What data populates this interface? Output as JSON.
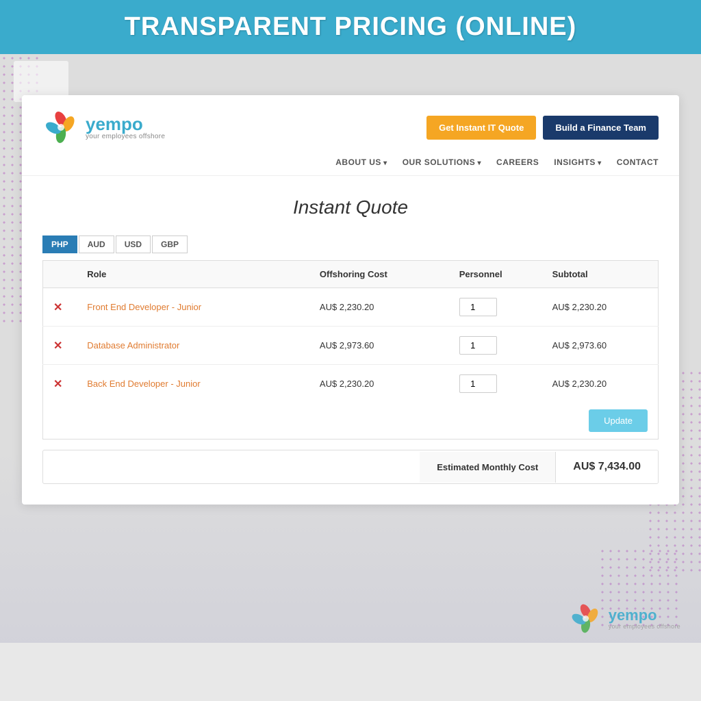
{
  "banner": {
    "title": "TRANSPARENT PRICING (ONLINE)"
  },
  "nav": {
    "logo_name": "yempo",
    "logo_tagline": "your employees offshore",
    "btn_quote_label": "Get Instant IT Quote",
    "btn_finance_label": "Build a Finance Team",
    "menu_items": [
      {
        "label": "ABOUT US",
        "has_dropdown": true
      },
      {
        "label": "OUR SOLUTIONS",
        "has_dropdown": true
      },
      {
        "label": "CAREERS",
        "has_dropdown": false
      },
      {
        "label": "INSIGHTS",
        "has_dropdown": true
      },
      {
        "label": "CONTACT",
        "has_dropdown": false
      }
    ]
  },
  "page": {
    "title": "Instant Quote"
  },
  "currency_tabs": [
    {
      "label": "PHP",
      "active": true
    },
    {
      "label": "AUD",
      "active": false
    },
    {
      "label": "USD",
      "active": false
    },
    {
      "label": "GBP",
      "active": false
    }
  ],
  "table": {
    "headers": {
      "role": "Role",
      "offshoring_cost": "Offshoring Cost",
      "personnel": "Personnel",
      "subtotal": "Subtotal"
    },
    "rows": [
      {
        "role": "Front End Developer - Junior",
        "offshoring_cost": "AU$  2,230.20",
        "personnel": "1",
        "subtotal": "AU$  2,230.20"
      },
      {
        "role": "Database Administrator",
        "offshoring_cost": "AU$  2,973.60",
        "personnel": "1",
        "subtotal": "AU$  2,973.60"
      },
      {
        "role": "Back End Developer - Junior",
        "offshoring_cost": "AU$  2,230.20",
        "personnel": "1",
        "subtotal": "AU$  2,230.20"
      }
    ],
    "update_btn_label": "Update"
  },
  "estimated": {
    "label": "Estimated Monthly Cost",
    "value": "AU$  7,434.00"
  }
}
